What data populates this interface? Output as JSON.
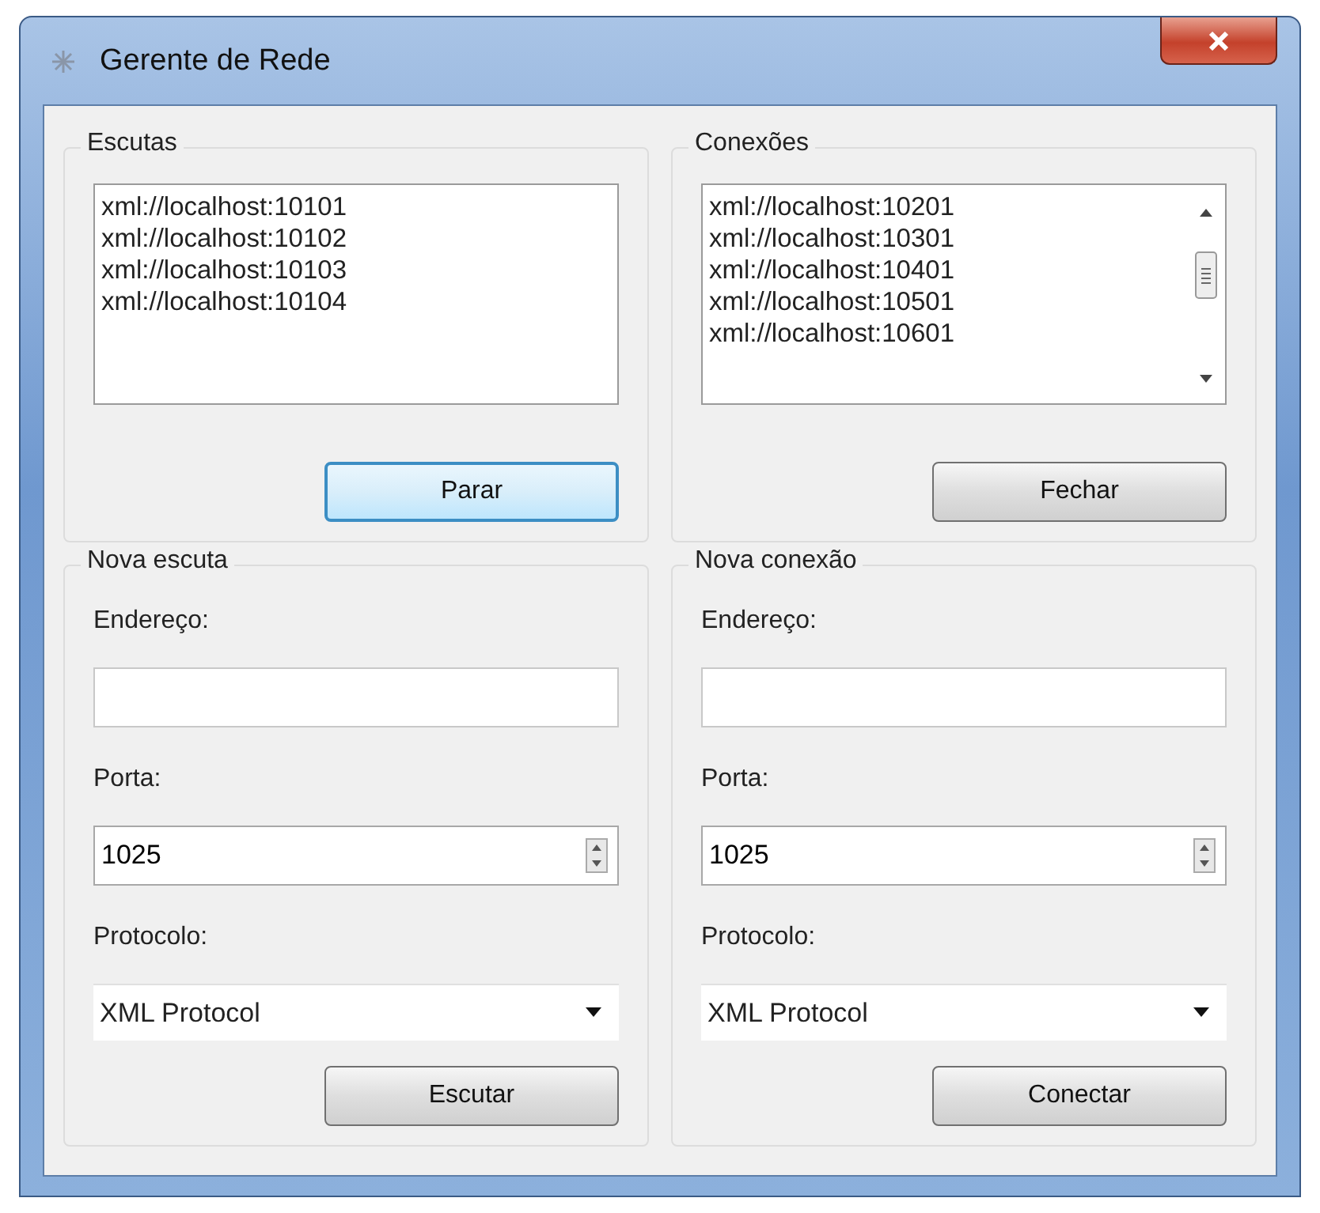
{
  "window": {
    "title": "Gerente de Rede"
  },
  "groups": [
    {
      "title": "Escutas",
      "kind": "list",
      "scrollbar": false,
      "items": [
        "xml://localhost:10101",
        "xml://localhost:10102",
        "xml://localhost:10103",
        "xml://localhost:10104"
      ],
      "button": {
        "label": "Parar",
        "focused": true
      }
    },
    {
      "title": "Conexões",
      "kind": "list",
      "scrollbar": true,
      "items": [
        "xml://localhost:10201",
        "xml://localhost:10301",
        "xml://localhost:10401",
        "xml://localhost:10501",
        "xml://localhost:10601"
      ],
      "button": {
        "label": "Fechar",
        "focused": false
      }
    },
    {
      "title": "Nova escuta",
      "kind": "form",
      "address_label": "Endereço:",
      "port_label": "Porta:",
      "port": "1025",
      "protocol_label": "Protocolo:",
      "protocol": "XML Protocol",
      "button": {
        "label": "Escutar",
        "focused": false
      }
    },
    {
      "title": "Nova conexão",
      "kind": "form",
      "address_label": "Endereço:",
      "port_label": "Porta:",
      "port": "1025",
      "protocol_label": "Protocolo:",
      "protocol": "XML Protocol",
      "button": {
        "label": "Conectar",
        "focused": false
      }
    }
  ]
}
